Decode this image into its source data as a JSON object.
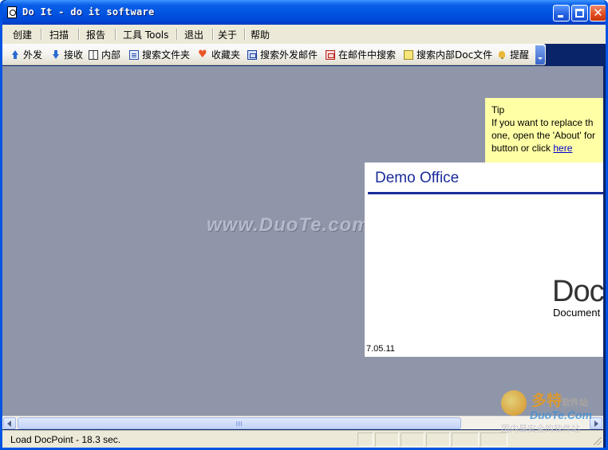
{
  "window": {
    "title": "Do It - do it software",
    "controls": {
      "minimize_icon": "minimize-icon",
      "maximize_icon": "maximize-icon",
      "close_glyph": "✕"
    }
  },
  "menu": {
    "items": [
      "创建",
      "扫描",
      "报告",
      "工具 Tools",
      "退出",
      "关于",
      "帮助"
    ]
  },
  "toolbar": {
    "items": [
      {
        "label": "外发",
        "icon": "arrow-up-icon"
      },
      {
        "label": "接收",
        "icon": "arrow-down-icon"
      },
      {
        "label": "内部",
        "icon": "book-icon"
      },
      {
        "label": "搜索文件夹",
        "icon": "card-icon"
      },
      {
        "label": "收藏夹",
        "icon": "heart-icon"
      },
      {
        "label": "搜索外发邮件",
        "icon": "mail-icon"
      },
      {
        "label": "在邮件中搜索",
        "icon": "mail-red-icon"
      },
      {
        "label": "搜索内部Doc文件",
        "icon": "doc-yellow-icon"
      },
      {
        "label": "提醒",
        "icon": "bell-icon"
      }
    ]
  },
  "tip": {
    "heading": "Tip",
    "line1": "If you want to replace th",
    "line2": "one, open the 'About' for",
    "line3_prefix": "button or click ",
    "link": "here"
  },
  "demo": {
    "title": "Demo Office",
    "logo": "Doc",
    "logo_sub": "Document",
    "version": "7.05.11"
  },
  "watermark": "www.DuoTe.com",
  "brand": {
    "name_cn": "多特",
    "name_cn_suffix": "软件站",
    "name_en": "DuoTe.Com",
    "slogan": "国内最安全的软件站"
  },
  "status": {
    "text": "Load DocPoint - 18.3 sec."
  },
  "colors": {
    "titlebar": "#0055e3",
    "content_bg": "#8f96a9",
    "tip_bg": "#ffffa6",
    "demo_accent": "#1a2c9a"
  }
}
